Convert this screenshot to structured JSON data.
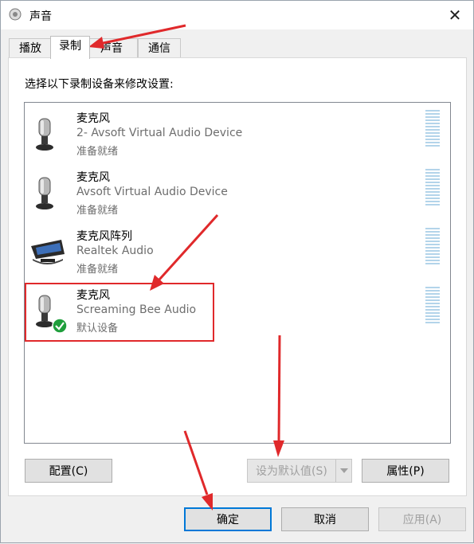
{
  "window": {
    "title": "声音"
  },
  "tabs": [
    {
      "label": "播放"
    },
    {
      "label": "录制"
    },
    {
      "label": "声音"
    },
    {
      "label": "通信"
    }
  ],
  "instruction": "选择以下录制设备来修改设置:",
  "devices": [
    {
      "name": "麦克风",
      "description": "2- Avsoft Virtual Audio Device",
      "status": "准备就绪",
      "icon": "microphone-icon"
    },
    {
      "name": "麦克风",
      "description": "Avsoft Virtual Audio Device",
      "status": "准备就绪",
      "icon": "microphone-icon"
    },
    {
      "name": "麦克风阵列",
      "description": "Realtek Audio",
      "status": "准备就绪",
      "icon": "microphone-array-icon"
    },
    {
      "name": "麦克风",
      "description": "Screaming Bee Audio",
      "status": "默认设备",
      "icon": "microphone-icon",
      "is_default": true
    }
  ],
  "buttons": {
    "configure": "配置(C)",
    "set_default": "设为默认值(S)",
    "properties": "属性(P)",
    "ok": "确定",
    "cancel": "取消",
    "apply": "应用(A)"
  },
  "colors": {
    "annotation": "#e0292b",
    "default_check": "#1e9e3b",
    "meter": "#b3d4ea"
  }
}
